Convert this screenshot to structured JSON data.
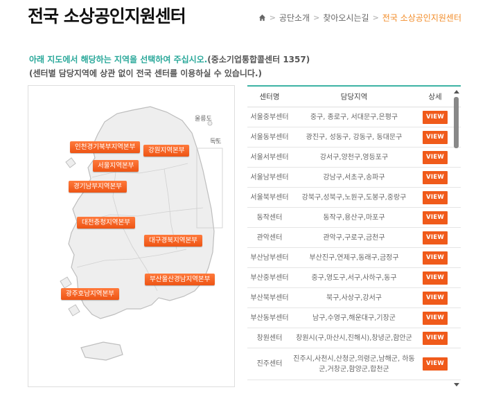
{
  "page": {
    "title": "전국 소상공인지원센터"
  },
  "breadcrumb": {
    "home_icon": "home-icon",
    "items": [
      "공단소개",
      "찾아오시는길"
    ],
    "current": "전국 소상공인지원센터",
    "sep": ">"
  },
  "intro": {
    "line1_highlight": "아래 지도에서 해당하는 지역을 선택하여 주십시오.",
    "line1_rest": "(중소기업통합콜센터 1357)",
    "line2": "(센터별 담당지역에 상관 없이 전국 센터를 이용하실 수 있습니다.)"
  },
  "map": {
    "islands": [
      "울릉도",
      "독도"
    ],
    "regions": [
      "인천경기북부지역본부",
      "강원지역본부",
      "서울지역본부",
      "경기남부지역본부",
      "대전충청지역본부",
      "대구경북지역본부",
      "부산울산경남지역본부",
      "광주호남지역본부"
    ]
  },
  "table": {
    "headers": {
      "name": "센터명",
      "area": "담당지역",
      "detail": "상세"
    },
    "view_label": "VIEW",
    "rows": [
      {
        "name": "서울중부센터",
        "area": "중구, 종로구, 서대문구,은평구"
      },
      {
        "name": "서울동부센터",
        "area": "광진구, 성동구, 강동구, 동대문구"
      },
      {
        "name": "서울서부센터",
        "area": "강서구,양천구,영등포구"
      },
      {
        "name": "서울남부센터",
        "area": "강남구,서초구,송파구"
      },
      {
        "name": "서울북부센터",
        "area": "강북구,성북구,노원구,도봉구,중랑구"
      },
      {
        "name": "동작센터",
        "area": "동작구,용산구,마포구"
      },
      {
        "name": "관악센터",
        "area": "관악구,구로구,금천구"
      },
      {
        "name": "부산남부센터",
        "area": "부산진구,연제구,동래구,금정구"
      },
      {
        "name": "부산중부센터",
        "area": "중구,영도구,서구,사하구,동구"
      },
      {
        "name": "부산북부센터",
        "area": "북구,사상구,강서구"
      },
      {
        "name": "부산동부센터",
        "area": "남구,수영구,해운대구,기장군"
      },
      {
        "name": "창원센터",
        "area": "창원시(구,마산시,진해시),창녕군,함안군"
      },
      {
        "name": "진주센터",
        "area": "진주시,사천시,산청군,의령군,남해군, 하동군,거창군,함양군,합천군"
      }
    ]
  },
  "colors": {
    "accent_teal": "#2aa89a",
    "accent_orange": "#f05a1a",
    "breadcrumb_current": "#f28c28"
  }
}
